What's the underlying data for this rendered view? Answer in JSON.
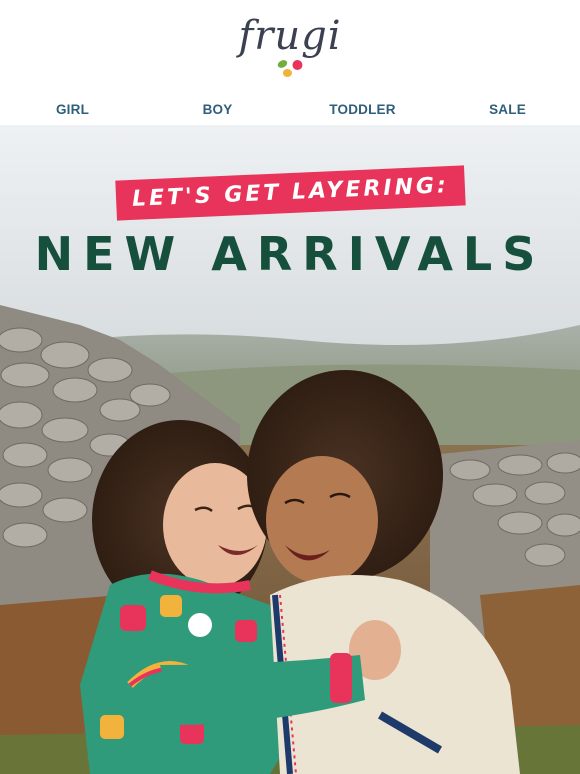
{
  "brand": {
    "logo_text": "frugi",
    "leaf_colors": [
      "#e8345a",
      "#f2b33d",
      "#6fae3f"
    ]
  },
  "nav": {
    "items": [
      {
        "label": "GIRL"
      },
      {
        "label": "BOY"
      },
      {
        "label": "TODDLER"
      },
      {
        "label": "SALE"
      }
    ]
  },
  "hero": {
    "tagline": "LET'S GET LAYERING:",
    "headline": "NEW ARRIVALS",
    "image_alt": "two-children-hugging-photo"
  },
  "colors": {
    "nav_text": "#2f5f7a",
    "tagline_bg": "#e8345a",
    "headline": "#16503c"
  }
}
